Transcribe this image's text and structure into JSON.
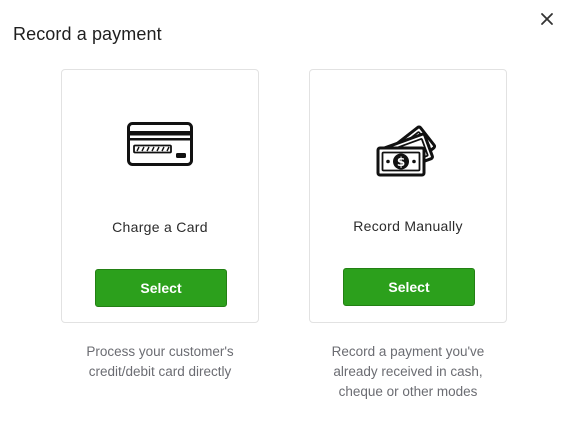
{
  "dialog": {
    "title": "Record a payment",
    "close_icon": "close-icon"
  },
  "options": [
    {
      "icon": "credit-card-icon",
      "label": "Charge a Card",
      "button_label": "Select",
      "description_lines": [
        "Process your customer's",
        "credit/debit card directly"
      ]
    },
    {
      "icon": "cash-icon",
      "label": "Record Manually",
      "button_label": "Select",
      "description_lines": [
        "Record a payment you've",
        "already received in cash,",
        "cheque or other modes"
      ]
    }
  ],
  "colors": {
    "button_green": "#2ca01c",
    "description_gray": "#6b6c72"
  }
}
